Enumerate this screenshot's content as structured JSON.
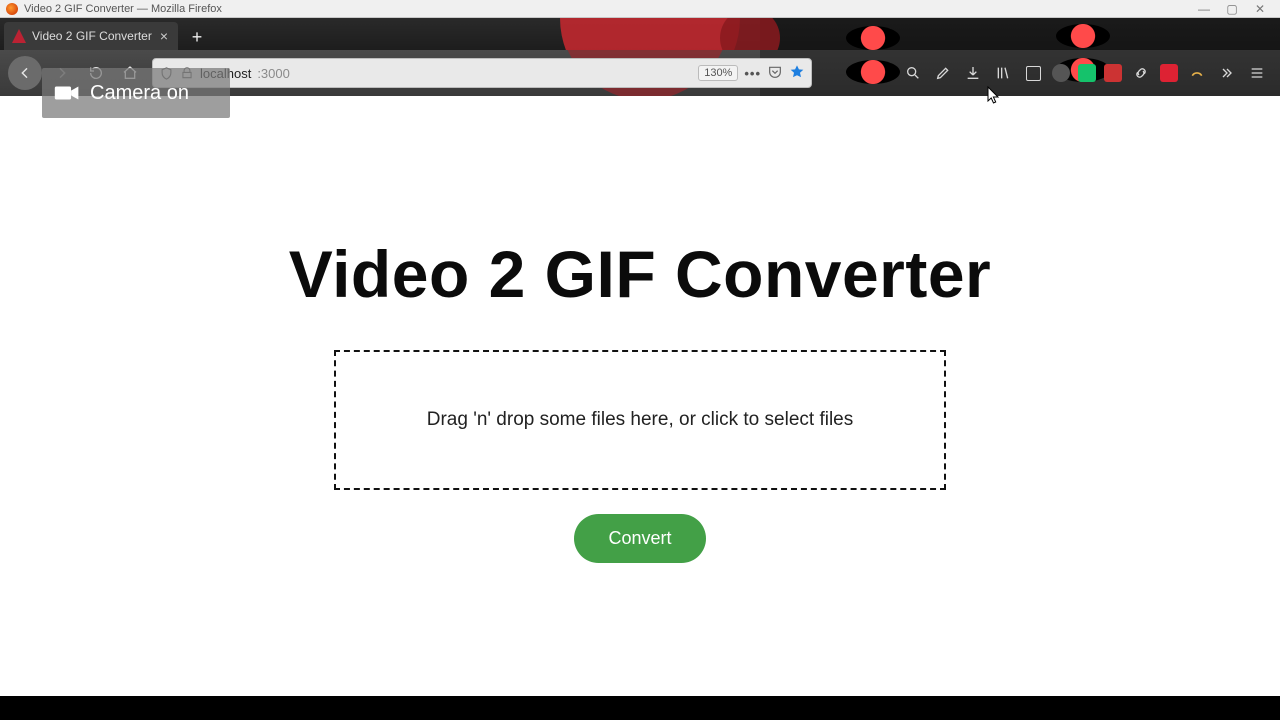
{
  "window": {
    "title": "Video 2 GIF Converter — Mozilla Firefox"
  },
  "tab": {
    "title": "Video 2 GIF Converter"
  },
  "nav": {
    "url_host": "localhost",
    "url_port": ":3000",
    "zoom_label": "130%"
  },
  "overlay": {
    "camera_label": "Camera on"
  },
  "page": {
    "heading": "Video 2 GIF Converter",
    "dropzone_text": "Drag 'n' drop some files here, or click to select files",
    "convert_label": "Convert"
  },
  "icons": {
    "back": "back-icon",
    "forward": "forward-icon",
    "reload": "reload-icon",
    "home": "home-icon",
    "shield": "shield-icon",
    "lock": "lock-icon",
    "menu_dots": "•••",
    "pocket": "pocket-icon",
    "bookmark_star": "star-icon",
    "hamburger": "hamburger-icon",
    "overflow": "overflow-chevrons-icon",
    "downloads": "downloads-icon",
    "library": "library-icon",
    "sidebar": "sidebar-icon"
  }
}
